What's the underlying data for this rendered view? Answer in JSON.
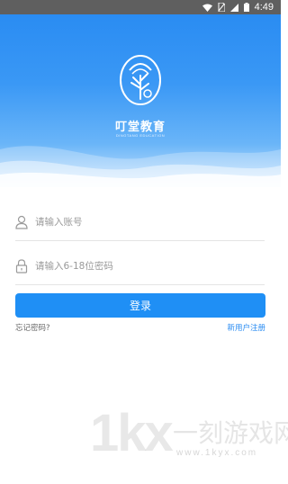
{
  "status_bar": {
    "time": "4:49",
    "icons": [
      "wifi-icon",
      "sim-off-icon",
      "signal-icon",
      "battery-icon"
    ]
  },
  "brand": {
    "name": "叮堂教育",
    "subtitle": "DINGTANG EDUCATION"
  },
  "login_form": {
    "account_placeholder": "请输入账号",
    "password_placeholder": "请输入6-18位密码",
    "login_button": "登录",
    "forgot_password": "忘记密码?",
    "register": "新用户注册"
  },
  "watermark": {
    "logo_text": "1kx",
    "site_name": "一刻游戏网",
    "url": "www.1kyx.com"
  },
  "colors": {
    "primary": "#1f8ff5",
    "hero_top": "#2a8cf2",
    "status_bar": "#5f5f5f"
  }
}
